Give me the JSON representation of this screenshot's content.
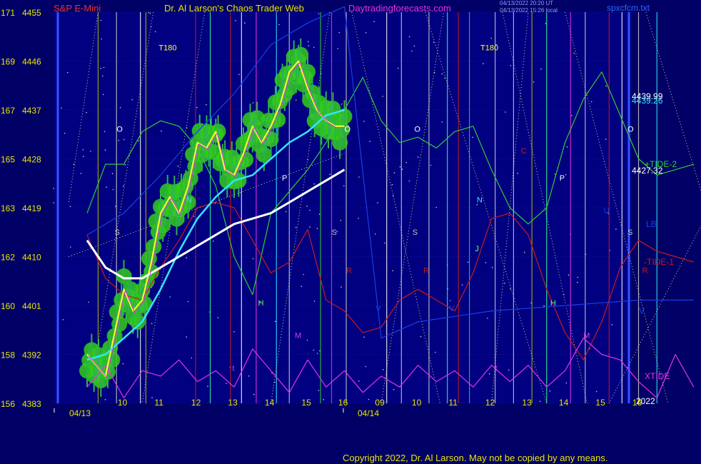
{
  "header": {
    "symbol": "S&P E-Mini",
    "site": "Dr. Al Larson's Chaos Trader Web",
    "url": "Daytradingforecasts.com",
    "timestamp1": "04/13/2022 20:20 UT",
    "timestamp2": "04/13/2022 15:26 local",
    "file": "spxcfcm.txt"
  },
  "copyright": "Copyright 2022, Dr. Al Larson. May not be copied by any means.",
  "colors": {
    "background": "#000066",
    "plot_background": "#000080",
    "price_bars": "#2db34a",
    "yellow_ma": "#ffff33",
    "cyan_ma": "#33e6ff",
    "white_ma": "#ffffff",
    "tide_plus": "#33cc33",
    "tide_minus": "#cc1a1a",
    "xtide": "#e633e6",
    "lb_line": "#1a3fe6"
  },
  "chart_data": {
    "type": "line",
    "title": "S&P E-Mini",
    "y_axis": {
      "left_ticks": [
        "171",
        "169",
        "167",
        "165",
        "163",
        "162",
        "160",
        "158",
        "156"
      ],
      "price_ticks": [
        4455,
        4446,
        4437,
        4428,
        4419,
        4410,
        4401,
        4392,
        4383
      ],
      "range": [
        4383,
        4455
      ]
    },
    "x_axis": {
      "hour_ticks": [
        "10",
        "11",
        "12",
        "13",
        "14",
        "15",
        "16",
        "09",
        "10",
        "11",
        "12",
        "13",
        "14",
        "15",
        "16"
      ],
      "dates": [
        "04/13",
        "04/14"
      ],
      "year": "2022"
    },
    "right_labels": [
      {
        "text": "4439.99",
        "price": 4439.5
      },
      {
        "text": "4439.26",
        "price": 4438.7
      },
      {
        "text": "+TIDE-2",
        "price": 4427.0
      },
      {
        "text": "4427.32",
        "price": 4425.8
      },
      {
        "text": "LB",
        "price": 4416.0
      },
      {
        "text": "-TIDE-1",
        "price": 4409.0
      },
      {
        "text": "V",
        "price": 4400.0
      },
      {
        "text": "XTIDE",
        "price": 4388.0
      }
    ],
    "series": [
      {
        "name": "+TIDE-2",
        "color": "#33cc33",
        "x": [
          0,
          0.5,
          1,
          1.5,
          2,
          2.5,
          3,
          3.5,
          4,
          4.5,
          5,
          5.5,
          6,
          6.5,
          7,
          7.5,
          8,
          8.5,
          9,
          9.5,
          10,
          10.5,
          11,
          11.5,
          12,
          12.5,
          13,
          13.5,
          14,
          14.5,
          15,
          15.5,
          16,
          16.5
        ],
        "y": [
          4418,
          4427,
          4427,
          4433,
          4435,
          4434,
          4430,
          4423,
          4410,
          4403,
          4418,
          4422,
          4426,
          4431,
          4437,
          4443,
          4435,
          4431,
          4432,
          4430,
          4433,
          4434,
          4426,
          4419,
          4416,
          4419,
          4431,
          4439,
          4444,
          4436,
          4428,
          4425,
          4426,
          4427
        ]
      },
      {
        "name": "-TIDE-1",
        "color": "#cc1a1a",
        "x": [
          0,
          0.5,
          1,
          1.5,
          2,
          2.5,
          3,
          3.5,
          4,
          4.5,
          5,
          5.5,
          6,
          6.5,
          7,
          7.5,
          8,
          8.5,
          9,
          9.5,
          10,
          10.5,
          11,
          11.5,
          12,
          12.5,
          13,
          13.5,
          14,
          14.5,
          15,
          15.5,
          16,
          16.5
        ],
        "y": [
          4414,
          4406,
          4403,
          4402,
          4408,
          4413,
          4419,
          4420,
          4419,
          4413,
          4407,
          4409,
          4415,
          4402,
          4400,
          4396,
          4397,
          4402,
          4404,
          4402,
          4400,
          4407,
          4417,
          4418,
          4414,
          4404,
          4396,
          4391,
          4398,
          4408,
          4413,
          4411,
          4410,
          4409
        ]
      },
      {
        "name": "LB",
        "color": "#1a3fe6",
        "x": [
          0,
          1,
          2,
          3,
          4,
          5,
          6,
          7,
          8,
          9,
          10,
          11,
          12,
          13,
          14,
          15,
          16,
          16.5
        ],
        "y": [
          4414,
          4418,
          4425,
          4433,
          4440,
          4449,
          4453,
          4456,
          4395,
          4398,
          4399,
          4400,
          4400.5,
          4401,
          4401.5,
          4402,
          4402,
          4402
        ]
      },
      {
        "name": "XTIDE",
        "color": "#e633e6",
        "x": [
          0,
          0.5,
          1,
          1.5,
          2,
          2.5,
          3,
          3.5,
          4,
          4.5,
          5,
          5.5,
          6,
          6.5,
          7,
          7.5,
          8,
          8.5,
          9,
          9.5,
          10,
          10.5,
          11,
          11.5,
          12,
          12.5,
          13,
          13.5,
          14,
          14.5,
          15,
          15.5,
          16,
          16.5
        ],
        "y": [
          4386,
          4390,
          4384,
          4389,
          4388,
          4391,
          4387,
          4389,
          4386,
          4393,
          4389,
          4385,
          4391,
          4386,
          4389,
          4385,
          4388,
          4386,
          4390,
          4387,
          4389,
          4386,
          4390,
          4387,
          4390,
          4386,
          4389,
          4395,
          4392,
          4391,
          4387,
          4384,
          4392,
          4386
        ]
      },
      {
        "name": "Price",
        "color": "#ffff33",
        "x": [
          0,
          0.25,
          0.5,
          0.75,
          1,
          1.25,
          1.5,
          1.75,
          2,
          2.25,
          2.5,
          2.75,
          3,
          3.25,
          3.5,
          3.75,
          4,
          4.25,
          4.5,
          4.75,
          5,
          5.25,
          5.5,
          5.75,
          6,
          6.25,
          6.5,
          6.75,
          7
        ],
        "y": [
          4392,
          4390,
          4388,
          4396,
          4404,
          4400,
          4402,
          4409,
          4418,
          4421,
          4418,
          4423,
          4431,
          4430,
          4433,
          4426,
          4425,
          4429,
          4434,
          4431,
          4434,
          4438,
          4444,
          4446,
          4441,
          4437,
          4435,
          4434,
          4434
        ]
      },
      {
        "name": "Cyan MA",
        "color": "#33e6ff",
        "x": [
          0,
          0.5,
          1,
          1.5,
          2,
          2.5,
          3,
          3.5,
          4,
          4.5,
          5,
          5.5,
          6,
          6.5,
          7
        ],
        "y": [
          4391,
          4392,
          4395,
          4398,
          4404,
          4411,
          4417,
          4421,
          4424,
          4425,
          4428,
          4431,
          4433,
          4436,
          4437
        ]
      },
      {
        "name": "White MA",
        "color": "#ffffff",
        "x": [
          0,
          0.5,
          1,
          1.5,
          2,
          2.5,
          3,
          3.5,
          4,
          4.5,
          5,
          5.5,
          6,
          6.5,
          7
        ],
        "y": [
          4413,
          4408,
          4406,
          4406,
          4408,
          4410,
          4412,
          4414,
          4416,
          4417,
          4418,
          4420,
          4422,
          4424,
          4426
        ]
      }
    ],
    "markers": [
      {
        "label": "T180",
        "x": 1.95,
        "price": 4448,
        "color": "#ffff33"
      },
      {
        "label": "T180",
        "x": 10.7,
        "price": 4448,
        "color": "#ffff33"
      },
      {
        "label": "O",
        "x": 0.8,
        "price": 4433,
        "color": "#ffffff"
      },
      {
        "label": "O",
        "x": 7.0,
        "price": 4433,
        "color": "#ffffff"
      },
      {
        "label": "O",
        "x": 8.9,
        "price": 4433,
        "color": "#ffffff"
      },
      {
        "label": "O",
        "x": 14.7,
        "price": 4433,
        "color": "#ffffff"
      },
      {
        "label": "S",
        "x": 0.75,
        "price": 4414,
        "color": "#c0c0c0"
      },
      {
        "label": "S",
        "x": 6.65,
        "price": 4414,
        "color": "#c0c0c0"
      },
      {
        "label": "S",
        "x": 8.85,
        "price": 4414,
        "color": "#c0c0c0"
      },
      {
        "label": "S",
        "x": 14.7,
        "price": 4414,
        "color": "#c0c0c0"
      },
      {
        "label": "N",
        "x": 2.7,
        "price": 4420,
        "color": "#33e6ff"
      },
      {
        "label": "N",
        "x": 10.6,
        "price": 4420,
        "color": "#33e6ff"
      },
      {
        "label": "P",
        "x": 5.3,
        "price": 4424,
        "color": "#ffffff"
      },
      {
        "label": "P",
        "x": 12.85,
        "price": 4424,
        "color": "#ffffff"
      },
      {
        "label": "H",
        "x": 4.65,
        "price": 4401,
        "color": "#66ff66"
      },
      {
        "label": "H",
        "x": 12.6,
        "price": 4401,
        "color": "#66ff66"
      },
      {
        "label": "J",
        "x": 10.55,
        "price": 4411,
        "color": "#66ff66"
      },
      {
        "label": "R",
        "x": 7.05,
        "price": 4407,
        "color": "#cc1a1a"
      },
      {
        "label": "R",
        "x": 9.15,
        "price": 4407,
        "color": "#cc1a1a"
      },
      {
        "label": "R",
        "x": 15.1,
        "price": 4407,
        "color": "#cc1a1a"
      },
      {
        "label": "C",
        "x": 11.8,
        "price": 4429,
        "color": "#cc1a1a"
      },
      {
        "label": "M",
        "x": 5.65,
        "price": 4395,
        "color": "#e633e6"
      },
      {
        "label": "M",
        "x": 13.5,
        "price": 4395,
        "color": "#e633e6"
      },
      {
        "label": "t",
        "x": 3.95,
        "price": 4389,
        "color": "#e633e6"
      },
      {
        "label": "t",
        "x": 11.1,
        "price": 4389,
        "color": "#e633e6"
      },
      {
        "label": "V",
        "x": 7.85,
        "price": 4400,
        "color": "#1a3fe6"
      },
      {
        "label": "V",
        "x": 9.85,
        "price": 4400,
        "color": "#1a3fe6"
      },
      {
        "label": "U",
        "x": 14.05,
        "price": 4418,
        "color": "#1a3fe6"
      }
    ],
    "ylim": [
      4383,
      4455
    ],
    "grid": true
  }
}
